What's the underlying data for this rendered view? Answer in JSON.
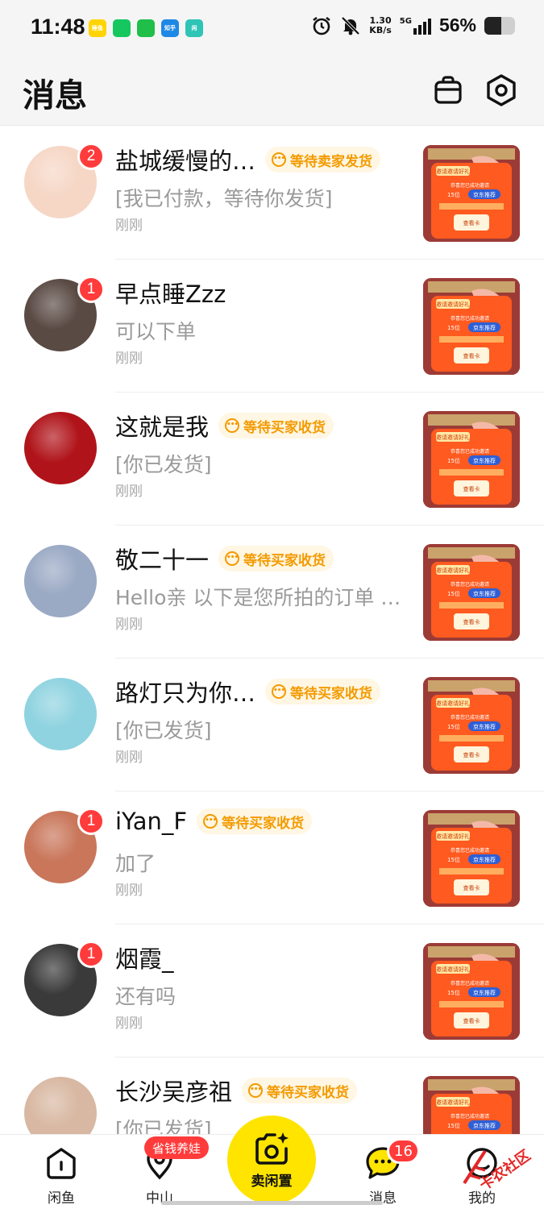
{
  "status_bar": {
    "time": "11:48",
    "apps": [
      {
        "name": "weather-app-icon",
        "label": "睡鱼",
        "color": "#ffd400"
      },
      {
        "name": "phone-app-icon",
        "label": "",
        "color": "#16c760"
      },
      {
        "name": "wechat-app-icon",
        "label": "",
        "color": "#1fbf4a"
      },
      {
        "name": "zhihu-app-icon",
        "label": "知乎",
        "color": "#1e88e5"
      },
      {
        "name": "xianyu-app-icon",
        "label": "闲",
        "color": "#2ec4b6"
      }
    ],
    "net_speed_value": "1.30",
    "net_speed_unit": "KB/s",
    "network": "5G",
    "battery_text": "56%",
    "battery_level": 0.56
  },
  "header": {
    "title": "消息"
  },
  "conversations": [
    {
      "name": "盐城缓慢的…",
      "tag": "等待卖家发货",
      "preview": "[我已付款，等待你发货]",
      "time": "刚刚",
      "badge": "2",
      "avatar_color": "#f6d7c6"
    },
    {
      "name": "早点睡Zzz",
      "tag": "",
      "preview": "可以下单",
      "time": "刚刚",
      "badge": "1",
      "avatar_color": "#5a4a44"
    },
    {
      "name": "这就是我",
      "tag": "等待买家收货",
      "preview": "[你已发货]",
      "time": "刚刚",
      "badge": "",
      "avatar_color": "#b0141a"
    },
    {
      "name": "敬二十一",
      "tag": "等待买家收货",
      "preview": "Hello亲 以下是您所拍的订单 …",
      "time": "刚刚",
      "badge": "",
      "avatar_color": "#9aa9c4"
    },
    {
      "name": "路灯只为你…",
      "tag": "等待买家收货",
      "preview": "[你已发货]",
      "time": "刚刚",
      "badge": "",
      "avatar_color": "#8fd3e0"
    },
    {
      "name": "iYan_F",
      "tag": "等待买家收货",
      "preview": "加了",
      "time": "刚刚",
      "badge": "1",
      "avatar_color": "#c9765a"
    },
    {
      "name": "烟霞_",
      "tag": "",
      "preview": "还有吗",
      "time": "刚刚",
      "badge": "1",
      "avatar_color": "#3a3a3a"
    },
    {
      "name": "长沙吴彦祖",
      "tag": "等待买家收货",
      "preview": "[你已发货]",
      "time": "",
      "badge": "",
      "avatar_color": "#d8b8a2"
    }
  ],
  "thumbnail": {
    "line1": "邀请邀请好礼",
    "line2": "恭喜您已成功邀请",
    "line3": "15位",
    "line4": "京东推荐",
    "line5": "查看卡"
  },
  "tabbar": {
    "tabs": [
      {
        "label": "闲鱼"
      },
      {
        "label": "中山"
      },
      {
        "label": "消息"
      },
      {
        "label": "我的"
      }
    ],
    "sell_label": "卖闲置",
    "promo": "省钱养娃",
    "message_badge": "16"
  },
  "watermark": "卡农社区"
}
